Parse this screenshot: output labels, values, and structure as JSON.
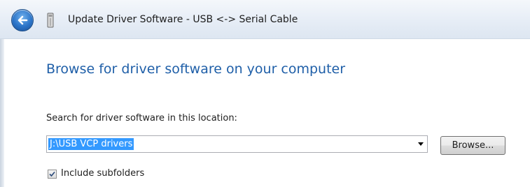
{
  "window": {
    "title": "Update Driver Software - USB <-> Serial Cable",
    "back_icon": "back-arrow-icon",
    "device_icon": "usb-device-icon"
  },
  "main": {
    "heading": "Browse for driver software on your computer",
    "path_label": "Search for driver software in this location:",
    "path_value": "J:\\USB VCP drivers",
    "browse_label": "Browse...",
    "include_subfolders_label": "Include subfolders",
    "include_subfolders_checked": true
  },
  "colors": {
    "heading": "#1f5fa8",
    "selection": "#3399ff"
  }
}
